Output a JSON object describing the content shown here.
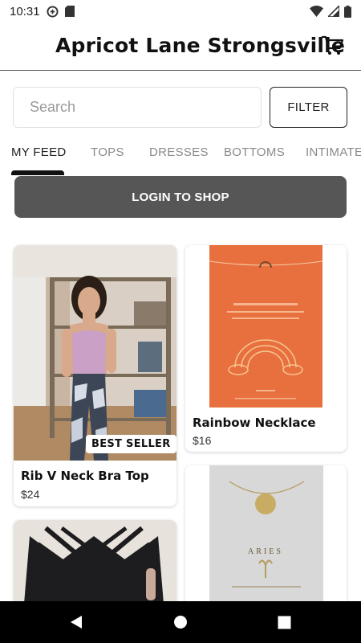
{
  "status_bar": {
    "time": "10:31"
  },
  "header": {
    "store_title": "Apricot Lane Strongsville"
  },
  "search": {
    "placeholder": "Search"
  },
  "filter": {
    "label": "FILTER"
  },
  "tabs": [
    {
      "label": "MY FEED",
      "active": true
    },
    {
      "label": "TOPS",
      "active": false
    },
    {
      "label": "DRESSES",
      "active": false
    },
    {
      "label": "BOTTOMS",
      "active": false
    },
    {
      "label": "INTIMATES",
      "active": false
    }
  ],
  "login": {
    "label": "LOGIN TO SHOP"
  },
  "products": [
    {
      "name": "Rib V Neck Bra Top",
      "price": "$24",
      "badge": "BEST SELLER"
    },
    {
      "name": "Rainbow Necklace",
      "price": "$16"
    },
    {
      "name": "",
      "price": ""
    },
    {
      "name": "",
      "price": ""
    }
  ],
  "colors": {
    "accent": "#565656",
    "necklace_card": "#e8703e"
  },
  "icons": [
    "signal-icon",
    "sd-card-icon",
    "wifi-icon",
    "cell-signal-icon",
    "battery-icon",
    "cart-icon",
    "back-icon",
    "home-icon",
    "recents-icon"
  ]
}
